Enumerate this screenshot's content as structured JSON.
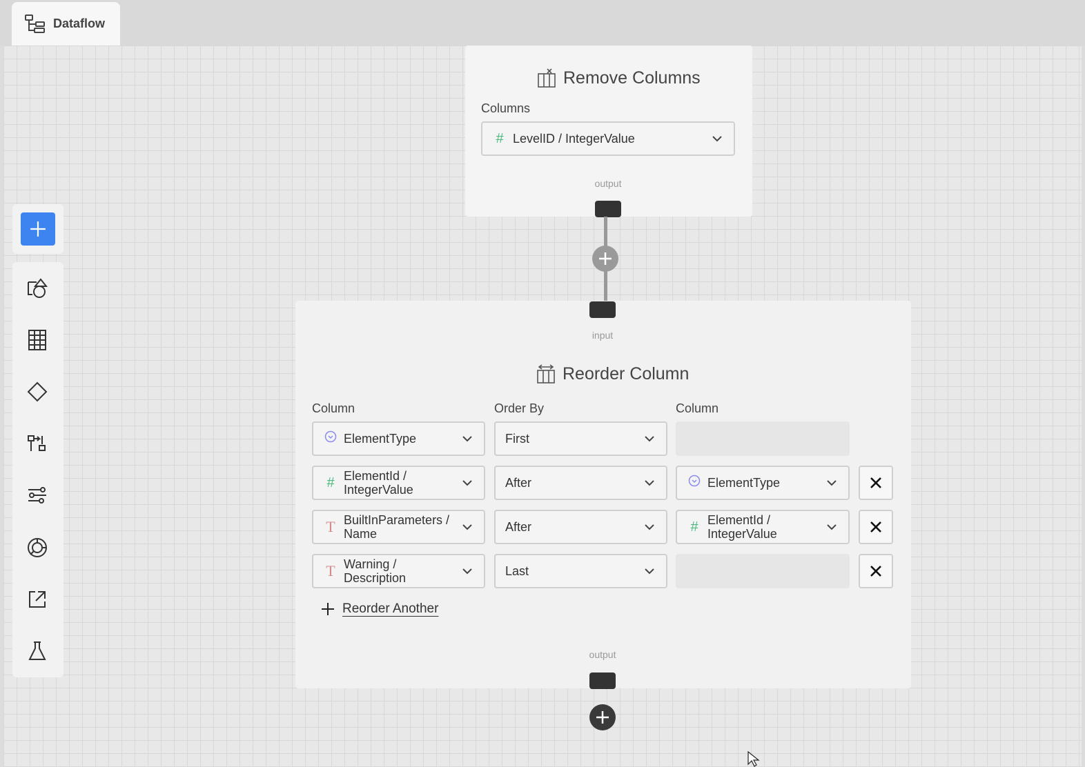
{
  "tab": {
    "label": "Dataflow",
    "icon": "dataflow-icon"
  },
  "toolbar": {
    "add_icon": "plus-icon",
    "tools": [
      "shapes-icon",
      "table-icon",
      "diamond-icon",
      "transform-icon",
      "filter-settings-icon",
      "chart-pie-icon",
      "export-icon",
      "flask-icon"
    ]
  },
  "remove_columns": {
    "title": "Remove Columns",
    "columns_label": "Columns",
    "columns_value": "LevelID / IntegerValue",
    "output_label": "output"
  },
  "reorder_column": {
    "input_label": "input",
    "title": "Reorder Column",
    "headers": {
      "column": "Column",
      "order_by": "Order By",
      "target_column": "Column"
    },
    "rows": [
      {
        "column": "ElementType",
        "column_type": "enum",
        "order": "First",
        "target": "",
        "target_type": ""
      },
      {
        "column": "ElementId / IntegerValue",
        "column_type": "number",
        "order": "After",
        "target": "ElementType",
        "target_type": "enum"
      },
      {
        "column": "BuiltInParameters / Name",
        "column_type": "text",
        "order": "After",
        "target": "ElementId / IntegerValue",
        "target_type": "number"
      },
      {
        "column": "Warning / Description",
        "column_type": "text",
        "order": "Last",
        "target": "",
        "target_type": ""
      }
    ],
    "reorder_another": "Reorder Another",
    "output_label": "output"
  },
  "colors": {
    "accent": "#3d84f0",
    "number_icon": "#4cba7d",
    "text_icon": "#d68a8a",
    "enum_icon": "#8a8af0"
  }
}
